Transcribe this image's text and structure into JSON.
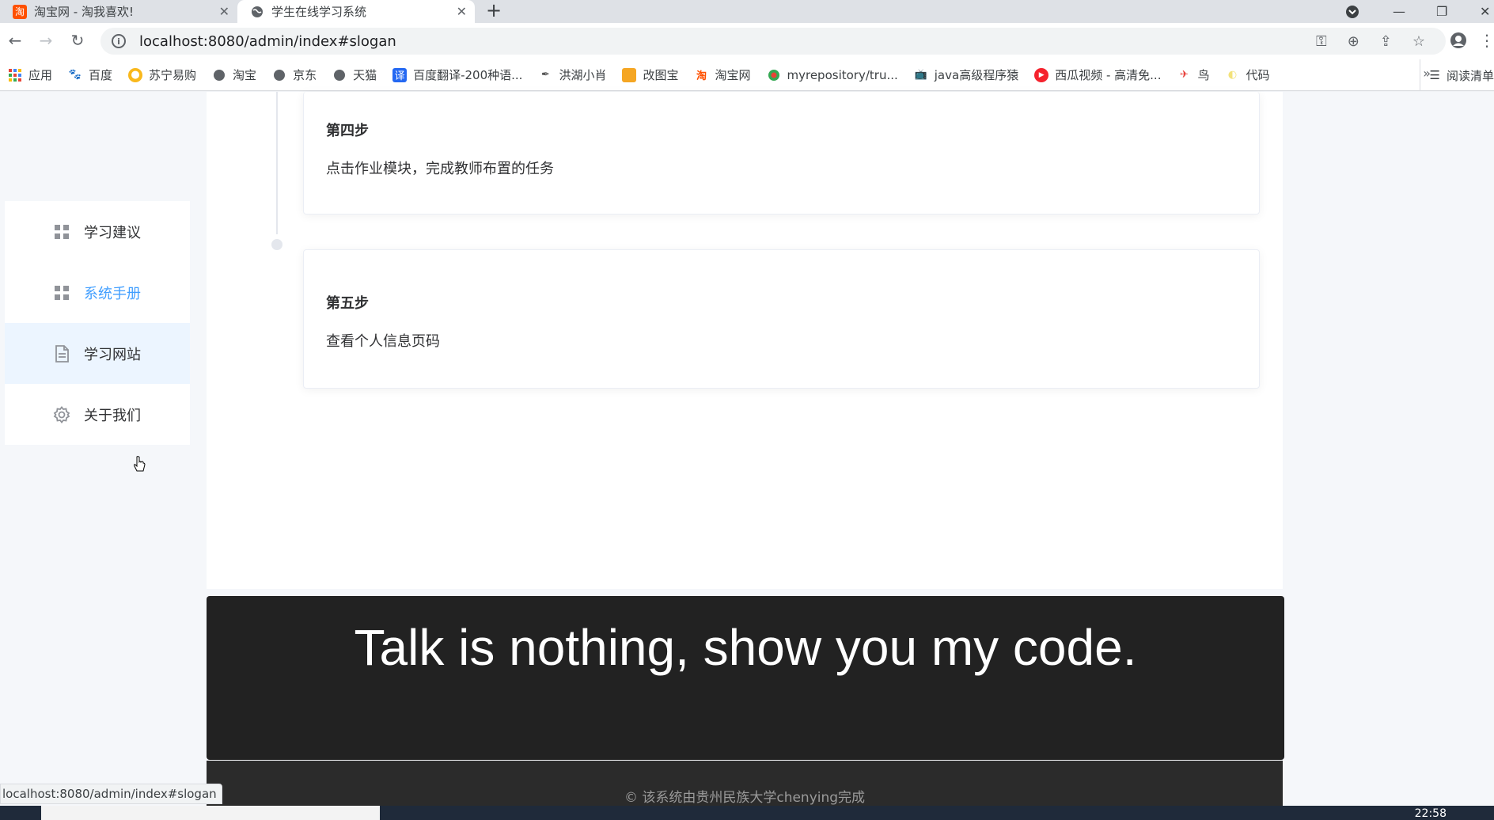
{
  "browser": {
    "tabs": [
      {
        "title": "淘宝网 - 淘我喜欢!",
        "active": false
      },
      {
        "title": "学生在线学习系统",
        "active": true
      }
    ],
    "address": "localhost:8080/admin/index#slogan",
    "bookmarks": [
      {
        "label": "应用",
        "icon": "apps-grid-icon"
      },
      {
        "label": "百度",
        "icon": "baidu-paw-icon"
      },
      {
        "label": "苏宁易购",
        "icon": "suning-icon"
      },
      {
        "label": "淘宝",
        "icon": "globe-icon"
      },
      {
        "label": "京东",
        "icon": "globe-icon"
      },
      {
        "label": "天猫",
        "icon": "globe-icon"
      },
      {
        "label": "百度翻译-200种语...",
        "icon": "translate-icon"
      },
      {
        "label": "洪湖小肖",
        "icon": "pen-icon"
      },
      {
        "label": "改图宝",
        "icon": "image-icon"
      },
      {
        "label": "淘宝网",
        "icon": "taobao-icon"
      },
      {
        "label": "myrepository/tru...",
        "icon": "repo-icon"
      },
      {
        "label": "java高级程序猿",
        "icon": "tv-icon"
      },
      {
        "label": "西瓜视频 - 高清免...",
        "icon": "play-icon"
      },
      {
        "label": "鸟",
        "icon": "bird-icon"
      },
      {
        "label": "代码",
        "icon": "code-icon"
      }
    ],
    "reading_list": "阅读清单",
    "status_url": "localhost:8080/admin/index#slogan"
  },
  "sidebar": {
    "items": [
      {
        "label": "学习建议",
        "icon": "grid-icon",
        "state": "normal"
      },
      {
        "label": "系统手册",
        "icon": "grid-icon",
        "state": "active"
      },
      {
        "label": "学习网站",
        "icon": "document-icon",
        "state": "hover"
      },
      {
        "label": "关于我们",
        "icon": "gear-icon",
        "state": "normal"
      }
    ]
  },
  "timeline": {
    "steps": [
      {
        "title": "第四步",
        "desc": "点击作业模块，完成教师布置的任务"
      },
      {
        "title": "第五步",
        "desc": "查看个人信息页码"
      }
    ]
  },
  "slogan": {
    "text": "Talk is nothing, show you my code."
  },
  "footer": {
    "text": "© 该系统由贵州民族大学chenying完成"
  },
  "taskbar": {
    "time": "22:58"
  },
  "colors": {
    "accent": "#409eff",
    "slogan_bg": "#222222",
    "footer_bg": "#2b2b2b"
  }
}
